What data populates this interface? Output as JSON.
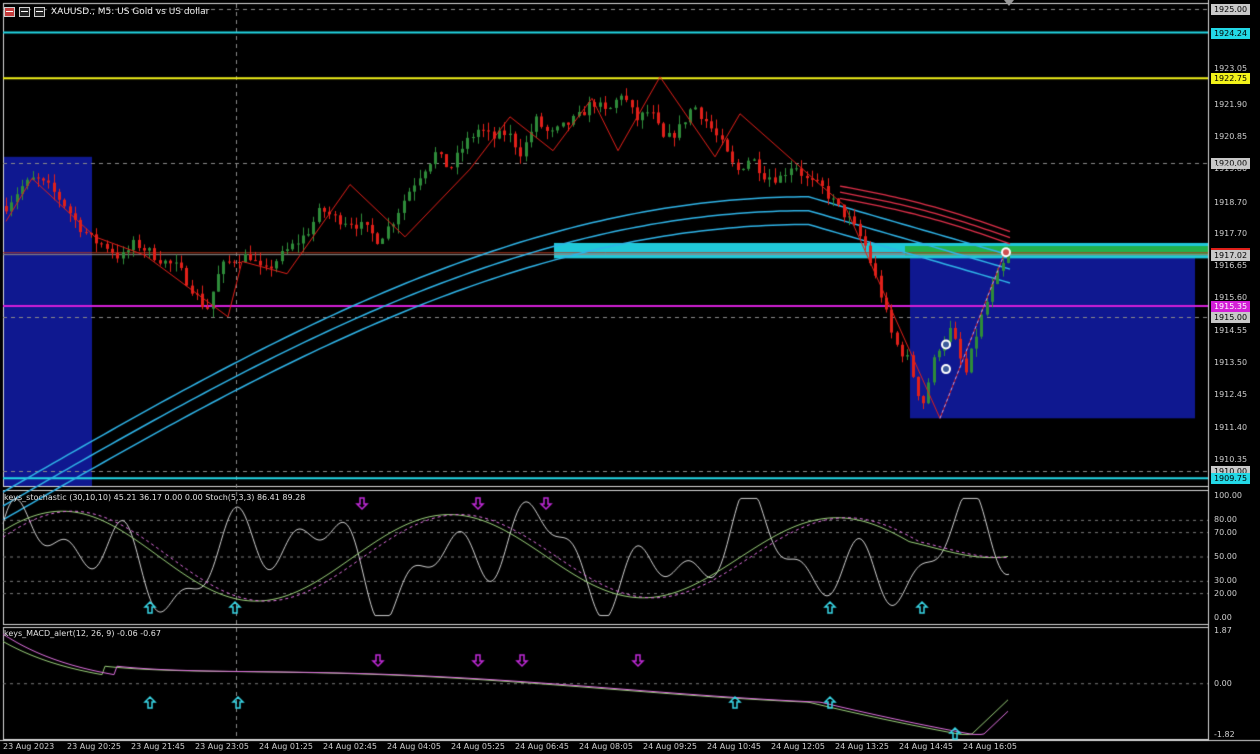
{
  "window": {
    "title": "XAUUSD., M5: US Gold vs US dollar"
  },
  "colors": {
    "background": "#000000",
    "bull_candle": "#2e8b3a",
    "bear_candle": "#e0201a",
    "zigzag": "#e0201a",
    "ma_blue": "#2fb4e8",
    "ma_red": "#e0304a",
    "level_cyan": "#23d8e6",
    "level_yellow": "#f2f21a",
    "level_magenta": "#d41fd8",
    "zone_blue": "#0f1890",
    "zone_cyan": "#20c8d8",
    "zone_green": "#22b14c",
    "arrow_up": "#39d6e6",
    "arrow_down": "#c02ad8"
  },
  "price_axis": {
    "ticks": [
      "1925.00",
      "1924.24",
      "1923.05",
      "1922.75",
      "1921.90",
      "1920.85",
      "1920.00",
      "1919.80",
      "1918.70",
      "1917.70",
      "1917.08",
      "1917.02",
      "1916.65",
      "1915.60",
      "1915.35",
      "1915.00",
      "1914.55",
      "1913.50",
      "1912.45",
      "1911.40",
      "1910.35",
      "1910.00",
      "1909.75"
    ],
    "highlighted": [
      {
        "value": "1925.00",
        "bg": "#c8c8c8",
        "fg": "#000000"
      },
      {
        "value": "1924.24",
        "bg": "#23d8e6",
        "fg": "#000000"
      },
      {
        "value": "1922.75",
        "bg": "#f2f21a",
        "fg": "#000000"
      },
      {
        "value": "1920.00",
        "bg": "#c8c8c8",
        "fg": "#000000"
      },
      {
        "value": "1917.08",
        "bg": "#e0201a",
        "fg": "#ffffff"
      },
      {
        "value": "1917.02",
        "bg": "#c8c8c8",
        "fg": "#000000"
      },
      {
        "value": "1915.35",
        "bg": "#d41fd8",
        "fg": "#ffffff"
      },
      {
        "value": "1915.00",
        "bg": "#c8c8c8",
        "fg": "#000000"
      },
      {
        "value": "1910.00",
        "bg": "#c8c8c8",
        "fg": "#000000"
      },
      {
        "value": "1909.75",
        "bg": "#23d8e6",
        "fg": "#000000"
      }
    ]
  },
  "time_axis": [
    "23 Aug 2023",
    "23 Aug 20:25",
    "23 Aug 21:45",
    "23 Aug 23:05",
    "24 Aug 01:25",
    "24 Aug 02:45",
    "24 Aug 04:05",
    "24 Aug 05:25",
    "24 Aug 06:45",
    "24 Aug 08:05",
    "24 Aug 09:25",
    "24 Aug 10:45",
    "24 Aug 12:05",
    "24 Aug 13:25",
    "24 Aug 14:45",
    "24 Aug 16:05"
  ],
  "stochastic": {
    "title": "keys_stochastic (30,10,10) 45.21 36.17 0.00 0.00 Stoch(5,3,3) 86.41 89.28",
    "levels": [
      "100.00",
      "80.00",
      "70.00",
      "50.00",
      "30.00",
      "20.00",
      "0.00"
    ]
  },
  "macd": {
    "title": "keys_MACD_alert(12, 26, 9) -0.06 -0.67",
    "levels": [
      "1.87",
      "0.00",
      "-1.82"
    ]
  },
  "chart_data": {
    "type": "candlestick",
    "symbol": "XAUUSD.",
    "timeframe": "M5",
    "ylim": [
      1909.5,
      1925.2
    ],
    "horizontal_levels": [
      1924.24,
      1922.75,
      1920.0,
      1917.08,
      1917.02,
      1915.35,
      1915.0,
      1910.0,
      1909.75
    ],
    "price_path": [
      1918.6,
      1919.2,
      1919.5,
      1919.2,
      1918.7,
      1918.0,
      1917.5,
      1917.3,
      1916.9,
      1917.4,
      1917.1,
      1916.8,
      1916.6,
      1915.9,
      1915.2,
      1916.6,
      1916.9,
      1917.0,
      1916.4,
      1916.9,
      1917.3,
      1917.7,
      1918.5,
      1918.2,
      1918.1,
      1917.9,
      1917.5,
      1918.1,
      1919.0,
      1919.7,
      1920.3,
      1919.8,
      1920.6,
      1921.1,
      1920.8,
      1921.0,
      1920.3,
      1921.4,
      1920.9,
      1921.2,
      1921.5,
      1922.0,
      1921.6,
      1922.3,
      1921.4,
      1921.7,
      1920.7,
      1921.1,
      1921.9,
      1921.3,
      1920.6,
      1919.7,
      1920.2,
      1919.6,
      1919.5,
      1920.0,
      1919.4,
      1919.2,
      1918.6,
      1918.1,
      1917.3,
      1915.9,
      1914.2,
      1913.6,
      1912.1,
      1913.9,
      1914.6,
      1913.1,
      1914.8,
      1916.1,
      1917.0
    ]
  }
}
